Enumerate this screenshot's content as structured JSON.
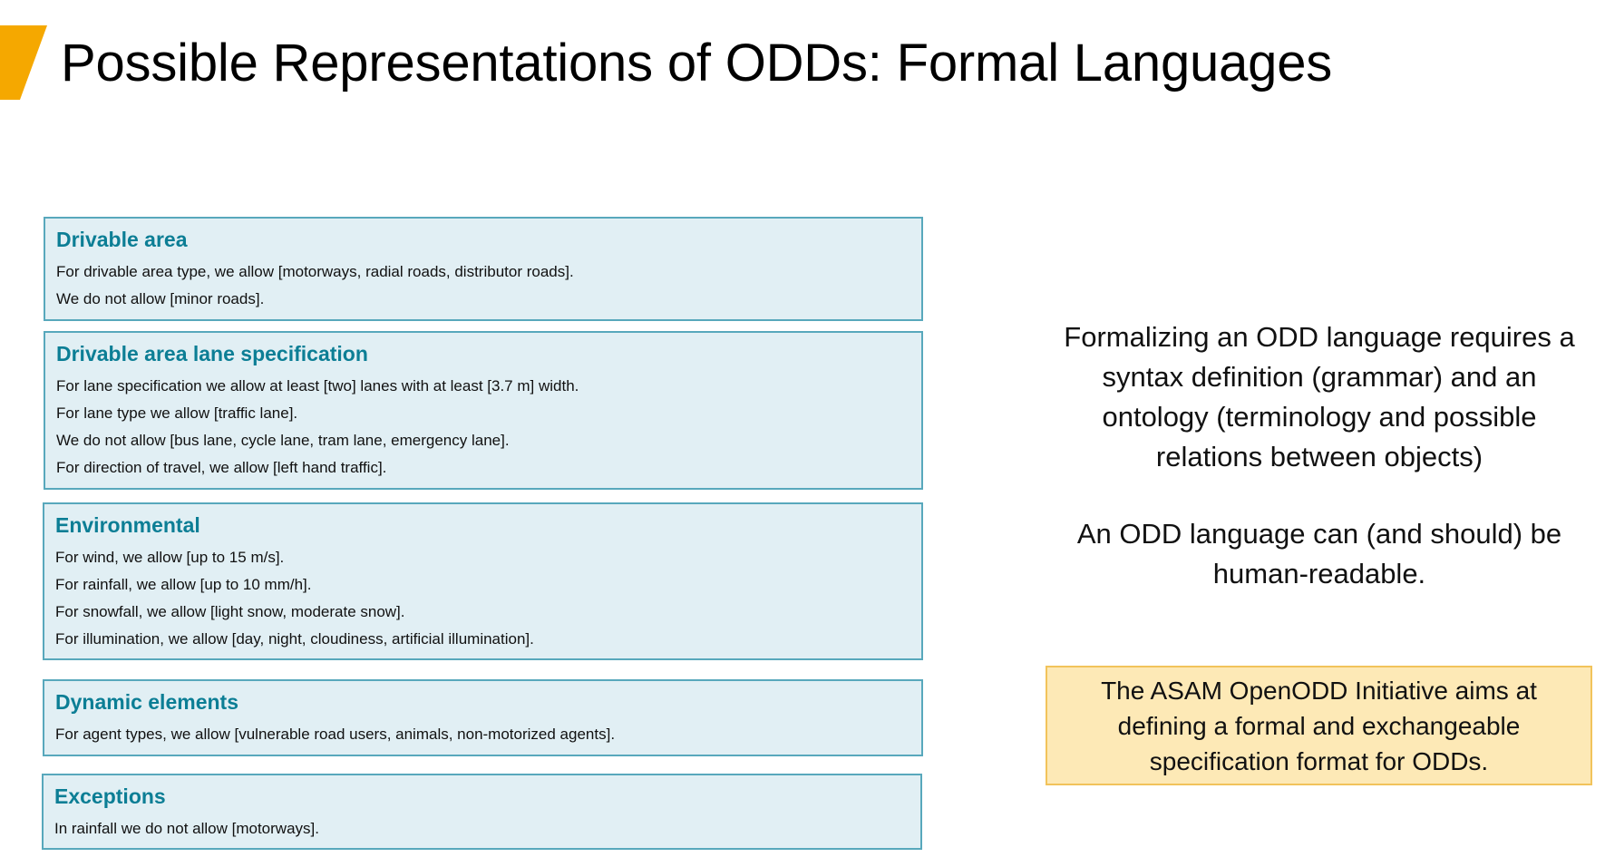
{
  "title": "Possible Representations of ODDs: Formal Languages",
  "colors": {
    "accent": "#f5a800",
    "box_fill": "#e1eff4",
    "box_border": "#58a8bc",
    "heading": "#0c7e95",
    "note_fill": "#fde9b6",
    "note_border": "#f2c35b"
  },
  "spec_boxes": [
    {
      "heading": "Drivable area",
      "lines": [
        "For drivable area type, we allow [motorways, radial roads, distributor roads].",
        "We do not allow [minor roads]."
      ]
    },
    {
      "heading": "Drivable area lane specification",
      "lines": [
        "For lane specification we allow at least [two] lanes with at least [3.7 m] width.",
        "For lane type we allow [traffic lane].",
        "We do not allow [bus lane, cycle lane, tram lane, emergency lane].",
        "For direction of travel, we allow [left hand traffic]."
      ]
    },
    {
      "heading": "Environmental",
      "lines": [
        "For wind, we allow [up to 15 m/s].",
        "For rainfall, we allow [up to 10 mm/h].",
        "For snowfall, we allow [light snow, moderate snow].",
        "For illumination, we allow [day, night, cloudiness, artificial illumination]."
      ]
    },
    {
      "heading": "Dynamic elements",
      "lines": [
        "For agent types, we allow [vulnerable road users, animals, non-motorized agents]."
      ]
    },
    {
      "heading": "Exceptions",
      "lines": [
        "In rainfall we do not allow [motorways]."
      ]
    }
  ],
  "right_panel": {
    "paragraph1": "Formalizing an ODD language requires a syntax definition (grammar) and an ontology (terminology and possible relations between objects)",
    "paragraph2": "An ODD language can (and should) be human-readable.",
    "note": "The ASAM OpenODD Initiative aims at defining a formal and exchangeable specification format for ODDs."
  }
}
